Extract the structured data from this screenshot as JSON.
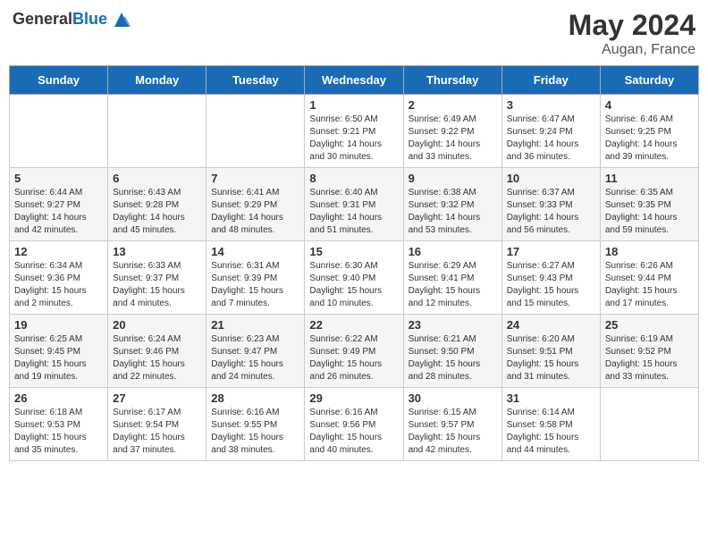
{
  "header": {
    "logo_general": "General",
    "logo_blue": "Blue",
    "month": "May 2024",
    "location": "Augan, France"
  },
  "weekdays": [
    "Sunday",
    "Monday",
    "Tuesday",
    "Wednesday",
    "Thursday",
    "Friday",
    "Saturday"
  ],
  "weeks": [
    [
      {
        "day": "",
        "info": ""
      },
      {
        "day": "",
        "info": ""
      },
      {
        "day": "",
        "info": ""
      },
      {
        "day": "1",
        "info": "Sunrise: 6:50 AM\nSunset: 9:21 PM\nDaylight: 14 hours\nand 30 minutes."
      },
      {
        "day": "2",
        "info": "Sunrise: 6:49 AM\nSunset: 9:22 PM\nDaylight: 14 hours\nand 33 minutes."
      },
      {
        "day": "3",
        "info": "Sunrise: 6:47 AM\nSunset: 9:24 PM\nDaylight: 14 hours\nand 36 minutes."
      },
      {
        "day": "4",
        "info": "Sunrise: 6:46 AM\nSunset: 9:25 PM\nDaylight: 14 hours\nand 39 minutes."
      }
    ],
    [
      {
        "day": "5",
        "info": "Sunrise: 6:44 AM\nSunset: 9:27 PM\nDaylight: 14 hours\nand 42 minutes."
      },
      {
        "day": "6",
        "info": "Sunrise: 6:43 AM\nSunset: 9:28 PM\nDaylight: 14 hours\nand 45 minutes."
      },
      {
        "day": "7",
        "info": "Sunrise: 6:41 AM\nSunset: 9:29 PM\nDaylight: 14 hours\nand 48 minutes."
      },
      {
        "day": "8",
        "info": "Sunrise: 6:40 AM\nSunset: 9:31 PM\nDaylight: 14 hours\nand 51 minutes."
      },
      {
        "day": "9",
        "info": "Sunrise: 6:38 AM\nSunset: 9:32 PM\nDaylight: 14 hours\nand 53 minutes."
      },
      {
        "day": "10",
        "info": "Sunrise: 6:37 AM\nSunset: 9:33 PM\nDaylight: 14 hours\nand 56 minutes."
      },
      {
        "day": "11",
        "info": "Sunrise: 6:35 AM\nSunset: 9:35 PM\nDaylight: 14 hours\nand 59 minutes."
      }
    ],
    [
      {
        "day": "12",
        "info": "Sunrise: 6:34 AM\nSunset: 9:36 PM\nDaylight: 15 hours\nand 2 minutes."
      },
      {
        "day": "13",
        "info": "Sunrise: 6:33 AM\nSunset: 9:37 PM\nDaylight: 15 hours\nand 4 minutes."
      },
      {
        "day": "14",
        "info": "Sunrise: 6:31 AM\nSunset: 9:39 PM\nDaylight: 15 hours\nand 7 minutes."
      },
      {
        "day": "15",
        "info": "Sunrise: 6:30 AM\nSunset: 9:40 PM\nDaylight: 15 hours\nand 10 minutes."
      },
      {
        "day": "16",
        "info": "Sunrise: 6:29 AM\nSunset: 9:41 PM\nDaylight: 15 hours\nand 12 minutes."
      },
      {
        "day": "17",
        "info": "Sunrise: 6:27 AM\nSunset: 9:43 PM\nDaylight: 15 hours\nand 15 minutes."
      },
      {
        "day": "18",
        "info": "Sunrise: 6:26 AM\nSunset: 9:44 PM\nDaylight: 15 hours\nand 17 minutes."
      }
    ],
    [
      {
        "day": "19",
        "info": "Sunrise: 6:25 AM\nSunset: 9:45 PM\nDaylight: 15 hours\nand 19 minutes."
      },
      {
        "day": "20",
        "info": "Sunrise: 6:24 AM\nSunset: 9:46 PM\nDaylight: 15 hours\nand 22 minutes."
      },
      {
        "day": "21",
        "info": "Sunrise: 6:23 AM\nSunset: 9:47 PM\nDaylight: 15 hours\nand 24 minutes."
      },
      {
        "day": "22",
        "info": "Sunrise: 6:22 AM\nSunset: 9:49 PM\nDaylight: 15 hours\nand 26 minutes."
      },
      {
        "day": "23",
        "info": "Sunrise: 6:21 AM\nSunset: 9:50 PM\nDaylight: 15 hours\nand 28 minutes."
      },
      {
        "day": "24",
        "info": "Sunrise: 6:20 AM\nSunset: 9:51 PM\nDaylight: 15 hours\nand 31 minutes."
      },
      {
        "day": "25",
        "info": "Sunrise: 6:19 AM\nSunset: 9:52 PM\nDaylight: 15 hours\nand 33 minutes."
      }
    ],
    [
      {
        "day": "26",
        "info": "Sunrise: 6:18 AM\nSunset: 9:53 PM\nDaylight: 15 hours\nand 35 minutes."
      },
      {
        "day": "27",
        "info": "Sunrise: 6:17 AM\nSunset: 9:54 PM\nDaylight: 15 hours\nand 37 minutes."
      },
      {
        "day": "28",
        "info": "Sunrise: 6:16 AM\nSunset: 9:55 PM\nDaylight: 15 hours\nand 38 minutes."
      },
      {
        "day": "29",
        "info": "Sunrise: 6:16 AM\nSunset: 9:56 PM\nDaylight: 15 hours\nand 40 minutes."
      },
      {
        "day": "30",
        "info": "Sunrise: 6:15 AM\nSunset: 9:57 PM\nDaylight: 15 hours\nand 42 minutes."
      },
      {
        "day": "31",
        "info": "Sunrise: 6:14 AM\nSunset: 9:58 PM\nDaylight: 15 hours\nand 44 minutes."
      },
      {
        "day": "",
        "info": ""
      }
    ]
  ]
}
